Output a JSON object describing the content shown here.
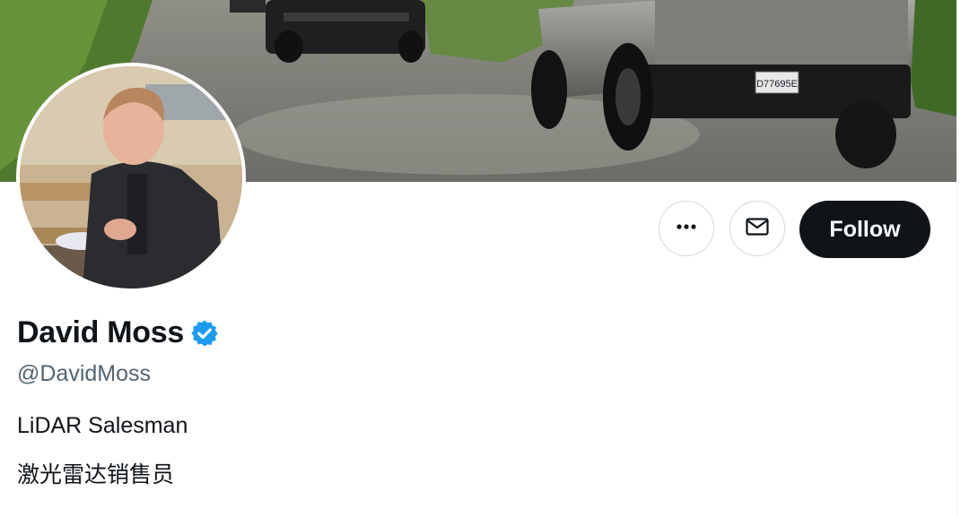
{
  "profile": {
    "name": "David Moss",
    "handle": "@DavidMoss",
    "bio_lines": [
      "LiDAR Salesman",
      "激光雷达销售员"
    ],
    "verified": true
  },
  "banner": {
    "license_plate": "D77695E"
  },
  "actions": {
    "more_icon": "more-icon",
    "message_icon": "envelope-icon",
    "follow_label": "Follow"
  },
  "colors": {
    "verified_blue": "#1d9bf0",
    "follow_bg": "#0f1419",
    "handle_gray": "#536471"
  }
}
